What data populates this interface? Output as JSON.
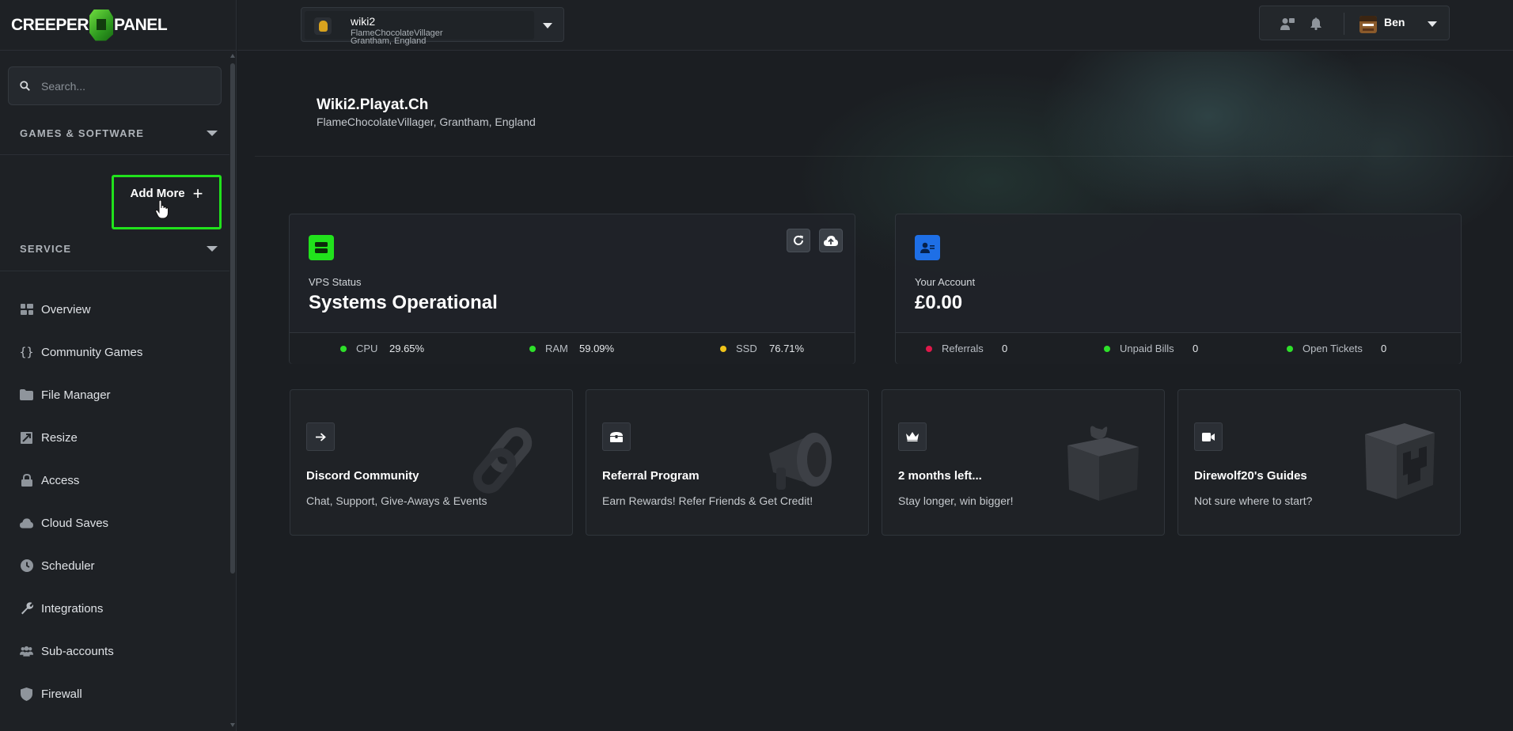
{
  "app": {
    "logo_left": "CREEPER",
    "logo_right": "PANEL"
  },
  "sidebar": {
    "search_placeholder": "Search...",
    "games_section": "GAMES & SOFTWARE",
    "add_more_label": "Add More",
    "service_section": "SERVICE",
    "items": [
      {
        "label": "Overview",
        "icon": "overview-grid-icon"
      },
      {
        "label": "Community Games",
        "icon": "braces-icon"
      },
      {
        "label": "File Manager",
        "icon": "folder-icon"
      },
      {
        "label": "Resize",
        "icon": "resize-icon"
      },
      {
        "label": "Access",
        "icon": "lock-icon"
      },
      {
        "label": "Cloud Saves",
        "icon": "cloud-icon"
      },
      {
        "label": "Scheduler",
        "icon": "clock-icon"
      },
      {
        "label": "Integrations",
        "icon": "wrench-icon"
      },
      {
        "label": "Sub-accounts",
        "icon": "users-icon"
      },
      {
        "label": "Firewall",
        "icon": "shield-icon"
      }
    ]
  },
  "topbar": {
    "server_name": "wiki2",
    "server_owner": "FlameChocolateVillager",
    "server_location": "Grantham, England",
    "user_name": "Ben"
  },
  "hero": {
    "title": "Wiki2.Playat.Ch",
    "subtitle": "FlameChocolateVillager, Grantham, England"
  },
  "vps": {
    "label": "VPS Status",
    "status": "Systems Operational",
    "metrics": [
      {
        "name": "CPU",
        "value": "29.65%",
        "color": "#2ee02a"
      },
      {
        "name": "RAM",
        "value": "59.09%",
        "color": "#2ee02a"
      },
      {
        "name": "SSD",
        "value": "76.71%",
        "color": "#f0c419"
      }
    ]
  },
  "account": {
    "label": "Your Account",
    "balance": "£0.00",
    "metrics": [
      {
        "name": "Referrals",
        "value": "0",
        "color": "#e0184a"
      },
      {
        "name": "Unpaid Bills",
        "value": "0",
        "color": "#2ee02a"
      },
      {
        "name": "Open Tickets",
        "value": "0",
        "color": "#2ee02a"
      }
    ]
  },
  "promos": [
    {
      "title": "Discord Community",
      "desc": "Chat, Support, Give-Aways & Events",
      "icon": "arrow-right-icon"
    },
    {
      "title": "Referral Program",
      "desc": "Earn Rewards! Refer Friends & Get Credit!",
      "icon": "treasure-chest-icon"
    },
    {
      "title": "2 months left...",
      "desc": "Stay longer, win bigger!",
      "icon": "crown-icon"
    },
    {
      "title": "Direwolf20's Guides",
      "desc": "Not sure where to start?",
      "icon": "video-camera-icon"
    }
  ],
  "colors": {
    "accent_green": "#21e21c",
    "account_blue": "#1e6fe6",
    "background": "#1b1e22"
  }
}
